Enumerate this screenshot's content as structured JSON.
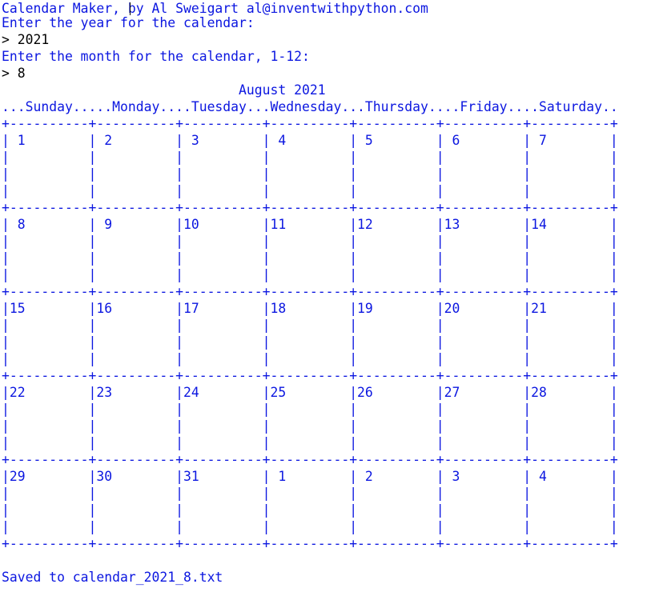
{
  "terminal": {
    "header": "Calendar Maker, by Al Sweigart al@inventwithpython.com",
    "prompt_year": "Enter the year for the calendar:",
    "input_year": "> 2021",
    "prompt_month": "Enter the month for the calendar, 1-12:",
    "input_month": "> 8",
    "calendar_title": "August 2021",
    "weekday_header": "...Sunday.....Monday....Tuesday...Wednesday...Thursday....Friday....Saturday..",
    "separator": "+----------+----------+----------+----------+----------+----------+----------+",
    "blank_row": "|          |          |          |          |          |          |          |",
    "weeks": [
      "| 1        | 2        | 3        | 4        | 5        | 6        | 7        |",
      "| 8        | 9        |10        |11        |12        |13        |14        |",
      "|15        |16        |17        |18        |19        |20        |21        |",
      "|22        |23        |24        |25        |26        |27        |28        |",
      "|29        |30        |31        | 1        | 2        | 3        | 4        |"
    ],
    "saved_message": "Saved to calendar_2021_8.txt"
  }
}
